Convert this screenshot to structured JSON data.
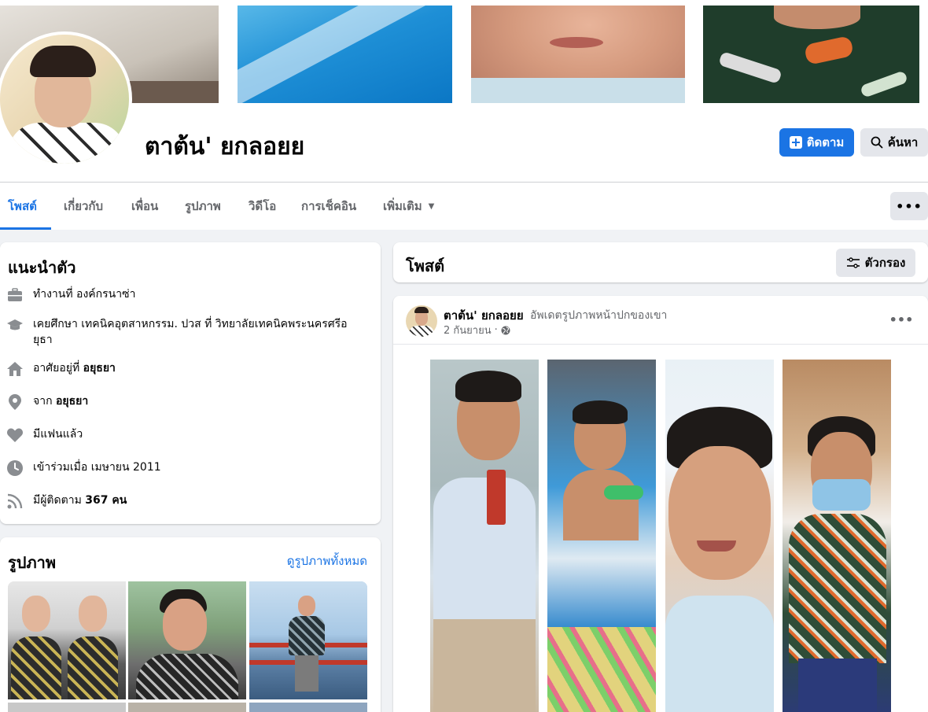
{
  "profile": {
    "name": "ตาต้น' ยกลอยย",
    "follow_label": "ติดตาม",
    "search_label": "ค้นหา"
  },
  "tabs": [
    {
      "label": "โพสต์",
      "active": true
    },
    {
      "label": "เกี่ยวกับ",
      "active": false
    },
    {
      "label": "เพื่อน",
      "active": false
    },
    {
      "label": "รูปภาพ",
      "active": false
    },
    {
      "label": "วิดีโอ",
      "active": false
    },
    {
      "label": "การเช็คอิน",
      "active": false
    },
    {
      "label": "เพิ่มเติม",
      "active": false
    }
  ],
  "more_options_label": "•••",
  "intro": {
    "title": "แนะนำตัว",
    "items": [
      {
        "icon": "briefcase-icon",
        "text": "ทำงานที่ องค์กรนาซ่า",
        "bold": ""
      },
      {
        "icon": "graduation-cap-icon",
        "text": "เคยศึกษา เทคนิคอุตสาหกรรม. ปวส ที่ วิทยาลัยเทคนิคพระนครศรีอยุธา",
        "bold": ""
      },
      {
        "icon": "home-icon",
        "text": "อาศัยอยู่ที่ ",
        "bold": "อยุธยา"
      },
      {
        "icon": "location-pin-icon",
        "text": "จาก ",
        "bold": "อยุธยา"
      },
      {
        "icon": "heart-icon",
        "text": "มีแฟนแล้ว",
        "bold": ""
      },
      {
        "icon": "clock-icon",
        "text": "เข้าร่วมเมื่อ เมษายน 2011",
        "bold": ""
      },
      {
        "icon": "rss-icon",
        "text": "มีผู้ติดตาม ",
        "bold": "367 คน"
      }
    ]
  },
  "photos": {
    "title": "รูปภาพ",
    "see_all_label": "ดูรูปภาพทั้งหมด"
  },
  "posts_section": {
    "title": "โพสต์",
    "filter_label": "ตัวกรอง"
  },
  "post": {
    "author": "ตาต้น' ยกลอยย",
    "action": "อัพเดตรูปภาพหน้าปกของเขา",
    "date": "2 กันยายน",
    "separator": "·",
    "options_label": "•••"
  },
  "colors": {
    "accent": "#1b74e4",
    "page_bg": "#f0f2f5",
    "secondary_text": "#65676b",
    "button_gray": "#e4e6eb"
  }
}
